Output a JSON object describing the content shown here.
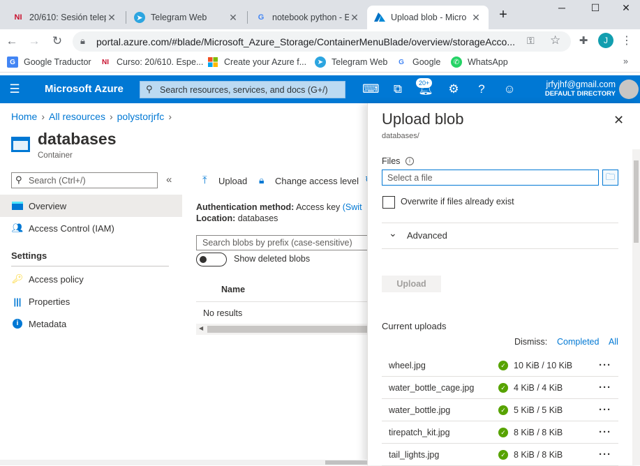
{
  "browser": {
    "tabs": [
      {
        "title": "20/610: Sesión telep",
        "favicon": "NI"
      },
      {
        "title": "Telegram Web",
        "favicon": "telegram-icon"
      },
      {
        "title": "notebook python - E",
        "favicon": "G"
      },
      {
        "title": "Upload blob - Micro",
        "favicon": "azure-icon"
      }
    ],
    "url": "portal.azure.com/#blade/Microsoft_Azure_Storage/ContainerMenuBlade/overview/storageAcco...",
    "profile_initial": "J",
    "bookmarks": [
      {
        "label": "Google Traductor",
        "icon": "translate-icon"
      },
      {
        "label": "Curso: 20/610. Espe...",
        "icon": "NI"
      },
      {
        "label": "Create your Azure f...",
        "icon": "microsoft-icon"
      },
      {
        "label": "Telegram Web",
        "icon": "telegram-icon"
      },
      {
        "label": "Google",
        "icon": "G"
      },
      {
        "label": "WhatsApp",
        "icon": "whatsapp-icon"
      }
    ]
  },
  "azure": {
    "brand": "Microsoft Azure",
    "search_placeholder": "Search resources, services, and docs (G+/)",
    "notification_count": "20+",
    "user_email": "jrfyjhf@gmail.com",
    "user_directory": "DEFAULT DIRECTORY"
  },
  "breadcrumb": [
    "Home",
    "All resources",
    "polystorjrfc"
  ],
  "resource": {
    "title": "databases",
    "subtitle": "Container"
  },
  "leftnav": {
    "search_placeholder": "Search (Ctrl+/)",
    "items": [
      {
        "label": "Overview",
        "icon": "overview-icon"
      },
      {
        "label": "Access Control (IAM)",
        "icon": "people-icon"
      }
    ],
    "settings_heading": "Settings",
    "settings_items": [
      {
        "label": "Access policy",
        "icon": "key-icon"
      },
      {
        "label": "Properties",
        "icon": "properties-icon"
      },
      {
        "label": "Metadata",
        "icon": "info-icon"
      }
    ]
  },
  "main": {
    "upload_label": "Upload",
    "change_access_label": "Change access level",
    "auth_label": "Authentication method:",
    "auth_value": "Access key",
    "auth_switch": "(Swit",
    "location_label": "Location:",
    "location_value": "databases",
    "search_placeholder": "Search blobs by prefix (case-sensitive)",
    "show_deleted_label": "Show deleted blobs",
    "col_name": "Name",
    "no_results": "No results"
  },
  "blade": {
    "title": "Upload blob",
    "subtitle": "databases/",
    "files_label": "Files",
    "file_placeholder": "Select a file",
    "overwrite_label": "Overwrite if files already exist",
    "advanced_label": "Advanced",
    "upload_button": "Upload",
    "current_uploads": "Current uploads",
    "dismiss_label": "Dismiss:",
    "dismiss_completed": "Completed",
    "dismiss_all": "All",
    "uploads": [
      {
        "name": "wheel.jpg",
        "progress": "10 KiB / 10 KiB"
      },
      {
        "name": "water_bottle_cage.jpg",
        "progress": "4 KiB / 4 KiB"
      },
      {
        "name": "water_bottle.jpg",
        "progress": "5 KiB / 5 KiB"
      },
      {
        "name": "tirepatch_kit.jpg",
        "progress": "8 KiB / 8 KiB"
      },
      {
        "name": "tail_lights.jpg",
        "progress": "8 KiB / 8 KiB"
      }
    ]
  }
}
